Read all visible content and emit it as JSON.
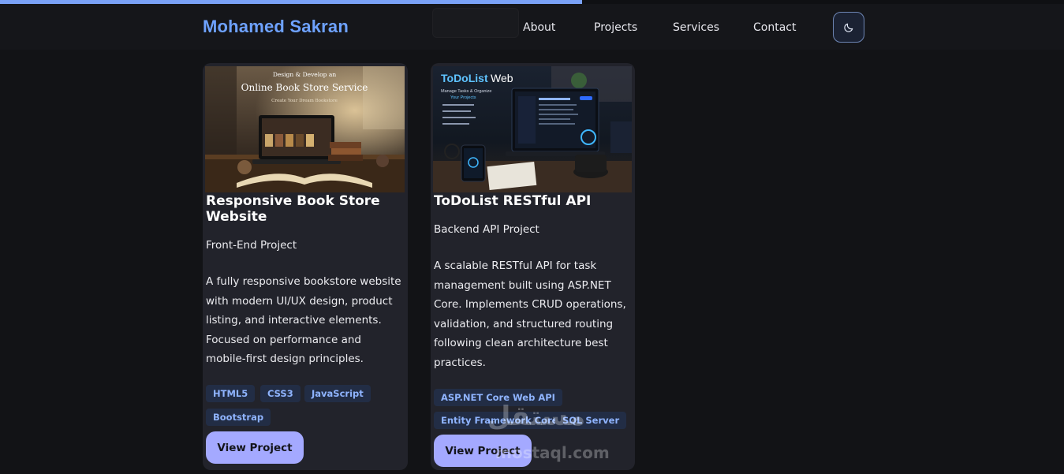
{
  "progress": {
    "fraction": 0.547
  },
  "header": {
    "logo": "Mohamed Sakran",
    "nav": [
      {
        "label": "About"
      },
      {
        "label": "Projects"
      },
      {
        "label": "Services"
      },
      {
        "label": "Contact"
      }
    ],
    "theme_icon": "moon-icon"
  },
  "colors": {
    "accent": "#6ea2ff",
    "button": "#a4a9ff",
    "card_bg": "#22232b",
    "tag_bg": "#222d45",
    "tag_text": "#8fb4ff"
  },
  "projects": [
    {
      "image_caption": "Design & Develop an",
      "image_title": "Online Book Store Service",
      "image_sub": "Create Your Dream Bookstore",
      "title": "Responsive Book Store Website",
      "subtitle": "Front-End Project",
      "description": "A fully responsive bookstore website with modern UI/UX design, product listing, and interactive elements. Focused on performance and mobile-first design principles.",
      "tags": [
        "HTML5",
        "CSS3",
        "JavaScript",
        "Bootstrap"
      ],
      "button": "View Project"
    },
    {
      "image_title_a": "ToDoList",
      "image_title_b": "Web",
      "image_sub": "Manage Tasks & Organize",
      "image_sub2": "Your Projects",
      "title": "ToDoList RESTful API",
      "subtitle": "Backend API Project",
      "description": "A scalable RESTful API for task management built using ASP.NET Core. Implements CRUD operations, validation, and structured routing following clean architecture best practices.",
      "tags": [
        "ASP.NET Core Web API",
        "Entity Framework Core",
        "SQL Server"
      ],
      "button": "View Project"
    }
  ],
  "watermark": {
    "arabic": "مستقل",
    "latin": "mostaql.com"
  }
}
